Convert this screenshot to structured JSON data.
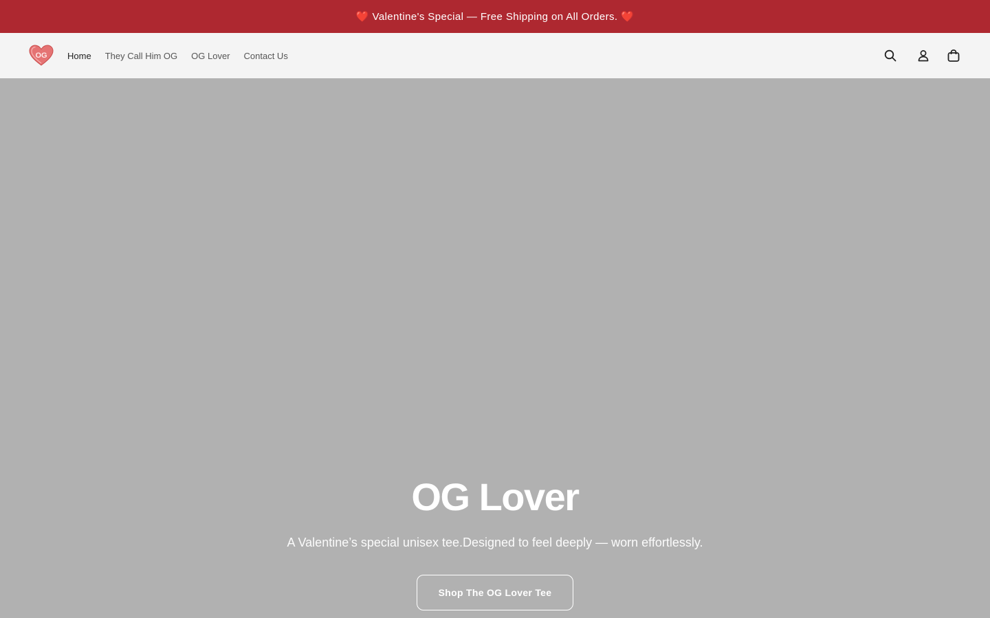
{
  "announcement": {
    "text": "❤️ Valentine's Special — Free Shipping on All Orders. ❤️"
  },
  "header": {
    "logo": {
      "text": "OG",
      "icon": "heart-logo-icon"
    },
    "nav": [
      {
        "label": "Home",
        "active": true
      },
      {
        "label": "They Call Him OG",
        "active": false
      },
      {
        "label": "OG Lover",
        "active": false
      },
      {
        "label": "Contact Us",
        "active": false
      }
    ],
    "icons": [
      "search-icon",
      "account-icon",
      "cart-icon"
    ]
  },
  "hero": {
    "title": "OG Lover",
    "subtitle": "A Valentine’s special unisex tee.Designed to feel deeply — worn effortlessly.",
    "cta_label": "Shop The OG Lover Tee"
  },
  "colors": {
    "announcement_bg": "#ae2830",
    "header_bg": "#f4f4f4",
    "hero_bg": "#b1b1b1",
    "logo_heart": "#e57373"
  }
}
